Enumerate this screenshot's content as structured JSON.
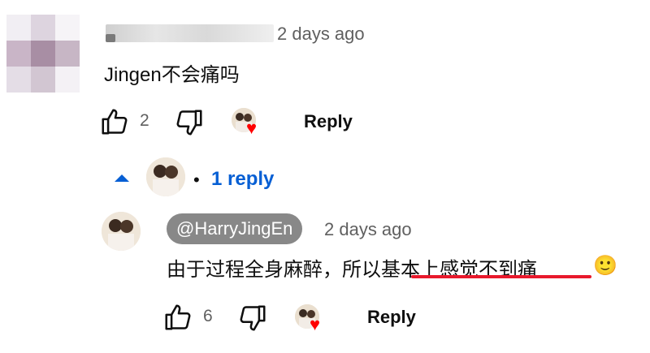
{
  "comment": {
    "timestamp": "2 days ago",
    "text": "Jingen不会痛吗",
    "like_count": "2",
    "reply_label": "Reply",
    "icons": [
      "like-icon",
      "dislike-icon",
      "creator-heart"
    ]
  },
  "thread": {
    "toggle_label": "1 reply",
    "bullet": "•"
  },
  "reply": {
    "author": "@HarryJingEn",
    "timestamp": "2 days ago",
    "text_plain": "由于过程全身麻醉，所以",
    "text_underlined": "基本上感觉不到痛",
    "emoji": "🙂",
    "like_count": "6",
    "reply_label": "Reply"
  },
  "colors": {
    "link_blue": "#065fd4",
    "heart_red": "#ff0000",
    "underline_red": "#e8192c",
    "author_chip": "#888888",
    "meta_gray": "#606060"
  }
}
